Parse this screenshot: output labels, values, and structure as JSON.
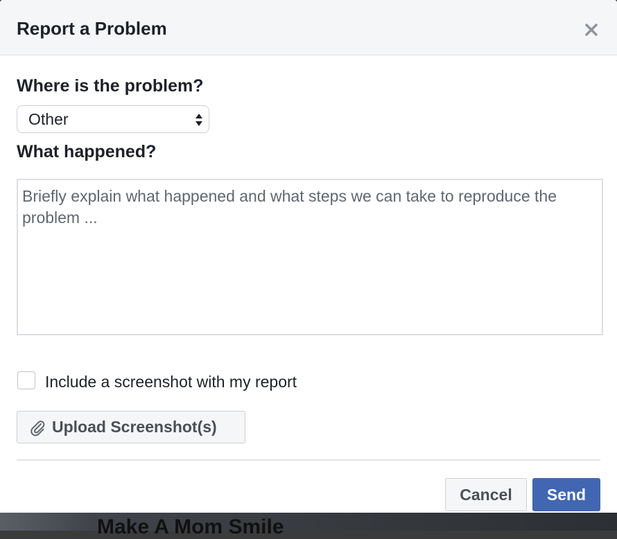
{
  "backdrop": {
    "text": "Make A Mom Smile"
  },
  "dialog": {
    "title": "Report a Problem",
    "close_icon": "close-icon",
    "where_label": "Where is the problem?",
    "location_select": {
      "selected": "Other"
    },
    "what_label": "What happened?",
    "description": {
      "placeholder": "Briefly explain what happened and what steps we can take to reproduce the problem ...",
      "value": ""
    },
    "include_screenshot": {
      "label": "Include a screenshot with my report",
      "checked": false
    },
    "upload_button": {
      "label": "Upload Screenshot(s)",
      "icon": "paperclip-icon"
    },
    "cancel_label": "Cancel",
    "send_label": "Send"
  },
  "colors": {
    "primary": "#4267b2",
    "header_bg": "#f5f6f7",
    "text": "#1d2129",
    "placeholder": "#606770"
  }
}
